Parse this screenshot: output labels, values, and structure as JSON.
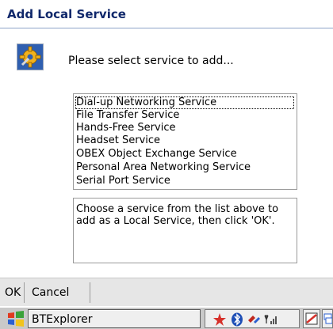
{
  "dialog": {
    "title": "Add Local Service",
    "prompt": "Please select service to add..."
  },
  "services": [
    "Dial-up Networking Service",
    "File Transfer Service",
    "Hands-Free Service",
    "Headset Service",
    "OBEX Object Exchange Service",
    "Personal Area Networking Service",
    "Serial Port Service"
  ],
  "selected_service_index": 0,
  "description": "Choose a service from the list above to add as a Local Service, then click 'OK'.",
  "commands": {
    "ok_label": "OK",
    "cancel_label": "Cancel"
  },
  "taskbar": {
    "active_window": "BTExplorer"
  },
  "colors": {
    "title_text": "#10286b",
    "command_bar": "#e6e6e6",
    "taskbar": "#c9c9c9"
  }
}
